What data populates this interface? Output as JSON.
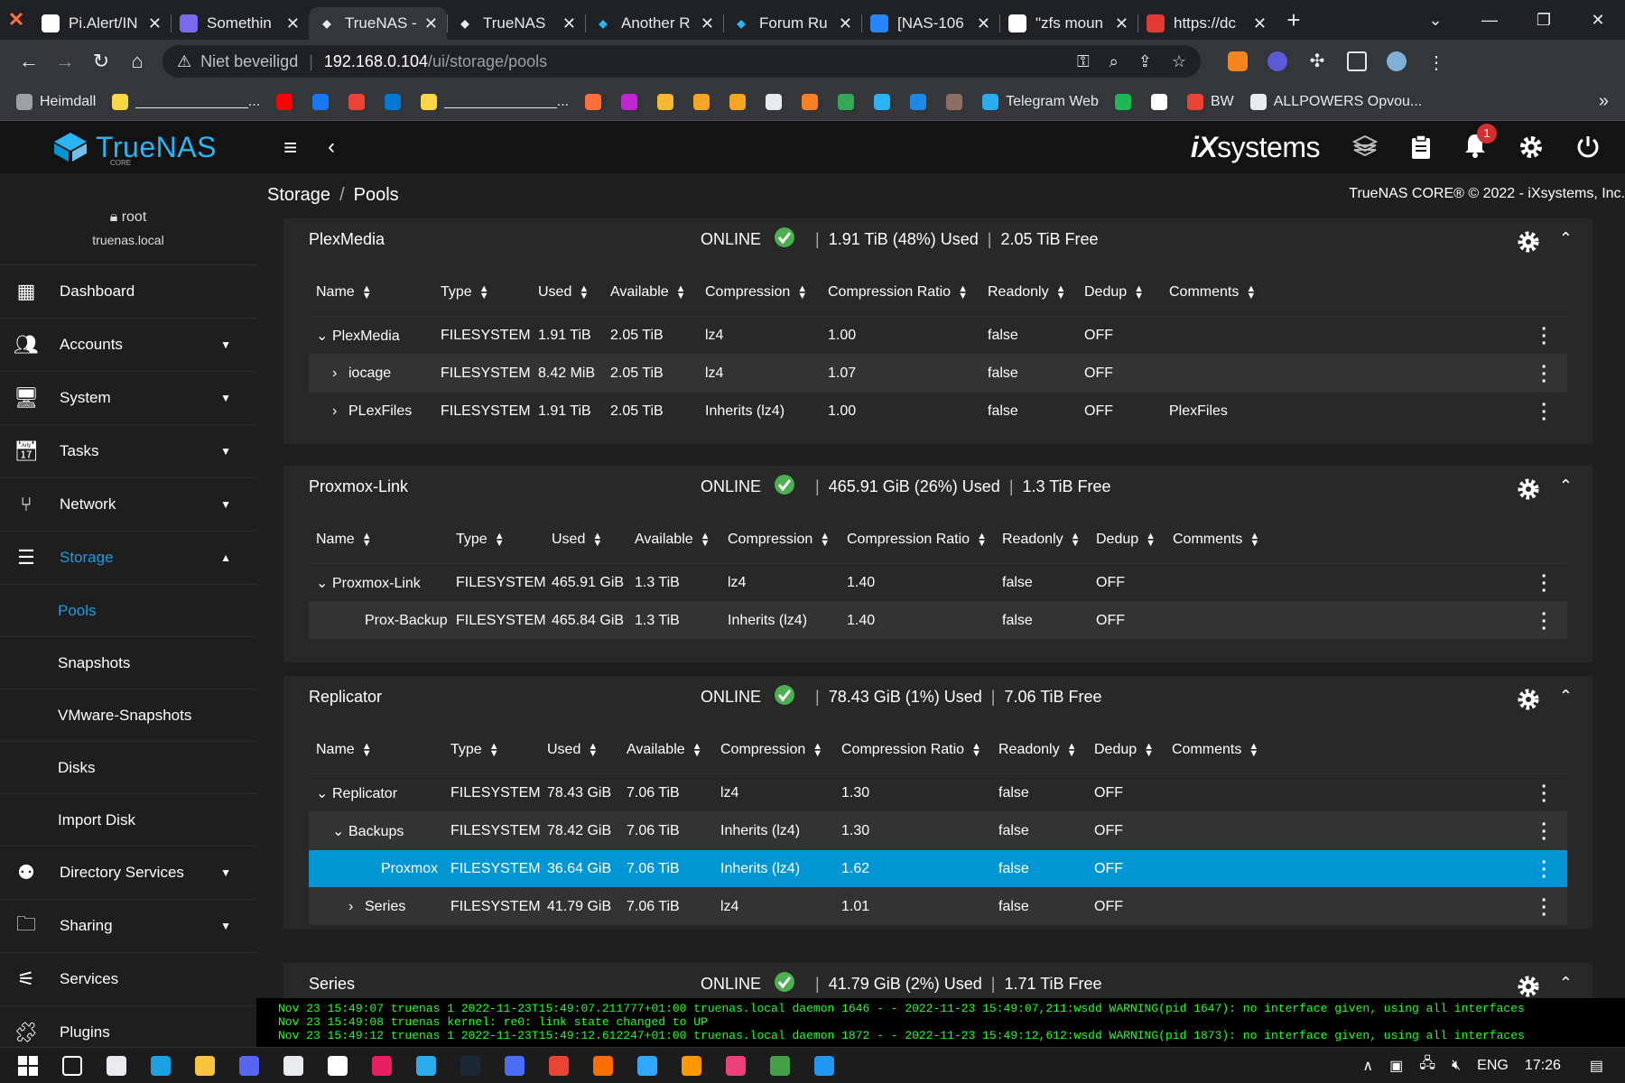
{
  "browser": {
    "tabs": [
      {
        "label": "Pi.Alert/IN",
        "favicon": "github-icon",
        "color": "#ffffff",
        "active": false
      },
      {
        "label": "Somethin",
        "favicon": "notion-icon",
        "color": "#7b68ee",
        "active": false
      },
      {
        "label": "TrueNAS -",
        "favicon": "truenas-icon",
        "color": "#e8eaed",
        "active": true
      },
      {
        "label": "TrueNAS",
        "favicon": "truenas-icon",
        "color": "#e8eaed",
        "active": false
      },
      {
        "label": "Another R",
        "favicon": "truenas-icon",
        "color": "#2bb4f4",
        "active": false
      },
      {
        "label": "Forum Ru",
        "favicon": "truenas-icon",
        "color": "#2bb4f4",
        "active": false
      },
      {
        "label": "[NAS-106",
        "favicon": "jira-icon",
        "color": "#2684ff",
        "active": false
      },
      {
        "label": "\"zfs moun",
        "favicon": "google-icon",
        "color": "#ffffff",
        "active": false
      },
      {
        "label": "https://dc",
        "favicon": "opera-icon",
        "color": "#e53935",
        "active": false
      }
    ],
    "address": {
      "insecure_label": "Niet beveiligd",
      "host": "192.168.0.104",
      "path": "/ui/storage/pools"
    },
    "bookmarks": [
      {
        "label": "Heimdall",
        "color": "#9aa0a6"
      },
      {
        "label": "______________...",
        "color": "#f9d648"
      },
      {
        "label": "",
        "color": "#ff0000"
      },
      {
        "label": "",
        "color": "#1877f2"
      },
      {
        "label": "",
        "color": "#ea4335"
      },
      {
        "label": "",
        "color": "#0078d4"
      },
      {
        "label": "______________...",
        "color": "#f9d648"
      },
      {
        "label": "",
        "color": "#ff6f3c"
      },
      {
        "label": "",
        "color": "#c026d3"
      },
      {
        "label": "",
        "color": "#f3ba2f"
      },
      {
        "label": "",
        "color": "#f6a623"
      },
      {
        "label": "",
        "color": "#f5a623"
      },
      {
        "label": "",
        "color": "#e8eaed"
      },
      {
        "label": "",
        "color": "#f58025"
      },
      {
        "label": "",
        "color": "#34a853"
      },
      {
        "label": "",
        "color": "#2bb4f4"
      },
      {
        "label": "",
        "color": "#1e88e5"
      },
      {
        "label": "",
        "color": "#8d6e63"
      },
      {
        "label": "Telegram Web",
        "color": "#2aabee"
      },
      {
        "label": "",
        "color": "#1db954"
      },
      {
        "label": "",
        "color": "#ffffff"
      },
      {
        "label": "BW",
        "color": "#ea4335"
      },
      {
        "label": "ALLPOWERS Opvou...",
        "color": "#e8eaed"
      }
    ]
  },
  "app": {
    "brand": "TrueNAS",
    "brand_sub": "CORE",
    "vendor": "iXsystems",
    "notification_count": "1",
    "user": "root",
    "host": "truenas.local",
    "copyright": "TrueNAS CORE® © 2022 - iXsystems, Inc.",
    "breadcrumb": [
      "Storage",
      "Pools"
    ]
  },
  "sidebar": {
    "items": [
      {
        "label": "Dashboard",
        "icon": "dashboard-icon",
        "caret": ""
      },
      {
        "label": "Accounts",
        "icon": "accounts-icon",
        "caret": "▼"
      },
      {
        "label": "System",
        "icon": "system-icon",
        "caret": "▼"
      },
      {
        "label": "Tasks",
        "icon": "tasks-icon",
        "caret": "▼"
      },
      {
        "label": "Network",
        "icon": "network-icon",
        "caret": "▼"
      },
      {
        "label": "Storage",
        "icon": "storage-icon",
        "caret": "▲"
      }
    ],
    "storage_sub": [
      "Pools",
      "Snapshots",
      "VMware-Snapshots",
      "Disks",
      "Import Disk"
    ],
    "items_after": [
      {
        "label": "Directory Services",
        "icon": "directory-services-icon",
        "caret": "▼"
      },
      {
        "label": "Sharing",
        "icon": "sharing-icon",
        "caret": "▼"
      },
      {
        "label": "Services",
        "icon": "services-icon",
        "caret": ""
      },
      {
        "label": "Plugins",
        "icon": "plugins-icon",
        "caret": ""
      }
    ]
  },
  "columns": [
    "Name",
    "Type",
    "Used",
    "Available",
    "Compression",
    "Compression Ratio",
    "Readonly",
    "Dedup",
    "Comments"
  ],
  "pools": [
    {
      "name": "PlexMedia",
      "status": "ONLINE",
      "used": "1.91 TiB (48%) Used",
      "free": "2.05 TiB Free",
      "rows": [
        {
          "name": "PlexMedia",
          "chev": "⌄",
          "type": "FILESYSTEM",
          "used": "1.91 TiB",
          "available": "2.05 TiB",
          "compression": "lz4",
          "ratio": "1.00",
          "readonly": "false",
          "dedup": "OFF",
          "comments": ""
        },
        {
          "name": "iocage",
          "chev": "›",
          "type": "FILESYSTEM",
          "used": "8.42 MiB",
          "available": "2.05 TiB",
          "compression": "lz4",
          "ratio": "1.07",
          "readonly": "false",
          "dedup": "OFF",
          "comments": ""
        },
        {
          "name": "PLexFiles",
          "chev": "›",
          "type": "FILESYSTEM",
          "used": "1.91 TiB",
          "available": "2.05 TiB",
          "compression": "Inherits (lz4)",
          "ratio": "1.00",
          "readonly": "false",
          "dedup": "OFF",
          "comments": "PlexFiles"
        }
      ]
    },
    {
      "name": "Proxmox-Link",
      "status": "ONLINE",
      "used": "465.91 GiB (26%) Used",
      "free": "1.3 TiB Free",
      "rows": [
        {
          "name": "Proxmox-Link",
          "chev": "⌄",
          "type": "FILESYSTEM",
          "used": "465.91 GiB",
          "available": "1.3 TiB",
          "compression": "lz4",
          "ratio": "1.40",
          "readonly": "false",
          "dedup": "OFF",
          "comments": ""
        },
        {
          "name": "Prox-Backup",
          "chev": "",
          "type": "FILESYSTEM",
          "used": "465.84 GiB",
          "available": "1.3 TiB",
          "compression": "Inherits (lz4)",
          "ratio": "1.40",
          "readonly": "false",
          "dedup": "OFF",
          "comments": ""
        }
      ]
    },
    {
      "name": "Replicator",
      "status": "ONLINE",
      "used": "78.43 GiB (1%) Used",
      "free": "7.06 TiB Free",
      "rows": [
        {
          "name": "Replicator",
          "chev": "⌄",
          "type": "FILESYSTEM",
          "used": "78.43 GiB",
          "available": "7.06 TiB",
          "compression": "lz4",
          "ratio": "1.30",
          "readonly": "false",
          "dedup": "OFF",
          "comments": ""
        },
        {
          "name": "Backups",
          "chev": "⌄",
          "type": "FILESYSTEM",
          "used": "78.42 GiB",
          "available": "7.06 TiB",
          "compression": "Inherits (lz4)",
          "ratio": "1.30",
          "readonly": "false",
          "dedup": "OFF",
          "comments": ""
        },
        {
          "name": "Proxmox",
          "chev": "",
          "type": "FILESYSTEM",
          "used": "36.64 GiB",
          "available": "7.06 TiB",
          "compression": "Inherits (lz4)",
          "ratio": "1.62",
          "readonly": "false",
          "dedup": "OFF",
          "comments": "",
          "selected": true
        },
        {
          "name": "Series",
          "chev": "›",
          "type": "FILESYSTEM",
          "used": "41.79 GiB",
          "available": "7.06 TiB",
          "compression": "lz4",
          "ratio": "1.01",
          "readonly": "false",
          "dedup": "OFF",
          "comments": ""
        }
      ]
    },
    {
      "name": "Series",
      "status": "ONLINE",
      "used": "41.79 GiB (2%) Used",
      "free": "1.71 TiB Free",
      "rows": []
    }
  ],
  "console": [
    "Nov 23 15:49:07 truenas 1 2022-11-23T15:49:07.211777+01:00 truenas.local daemon 1646 - - 2022-11-23 15:49:07,211:wsdd WARNING(pid 1647): no interface given, using all interfaces",
    "Nov 23 15:49:08 truenas kernel: re0: link state changed to UP",
    "Nov 23 15:49:12 truenas 1 2022-11-23T15:49:12.612247+01:00 truenas.local daemon 1872 - - 2022-11-23 15:49:12,612:wsdd WARNING(pid 1873): no interface given, using all interfaces"
  ],
  "taskbar": {
    "apps": [
      "#ffffff",
      "#e8eaed",
      "#1ba1e2",
      "#f9c440",
      "#5865f2",
      "#e8eaed",
      "#ffffff",
      "#e91e63",
      "#2aabee",
      "#1b2838",
      "#4a6cf7",
      "#ea4335",
      "#ff6f00",
      "#31a8ff",
      "#ff9800",
      "#ec407a",
      "#43a047",
      "#2196f3"
    ],
    "lang": "ENG",
    "time": "17:26"
  },
  "colors": {
    "accent": "#0095d5",
    "online": "#4caf50",
    "brand": "#2bb4f4"
  }
}
